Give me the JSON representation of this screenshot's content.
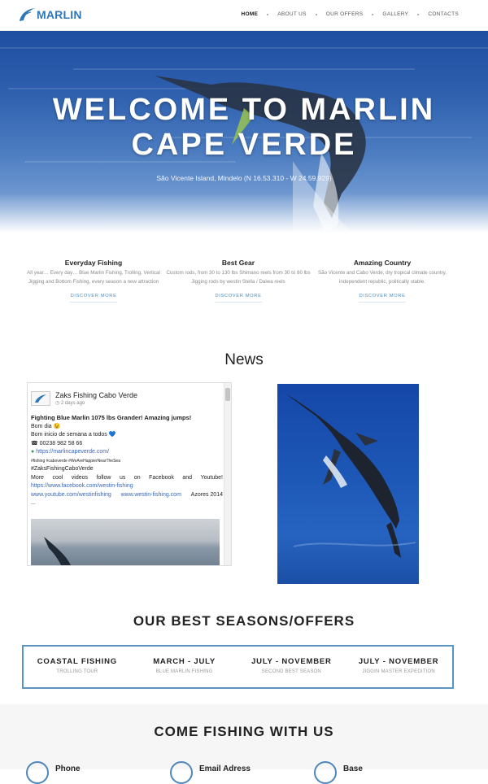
{
  "nav": {
    "logo_text": "MARLIN",
    "items": [
      {
        "label": "HOME",
        "active": true
      },
      {
        "label": "ABOUT US"
      },
      {
        "label": "OUR OFFERS"
      },
      {
        "label": "GALLERY"
      },
      {
        "label": "CONTACTS"
      }
    ]
  },
  "hero": {
    "title_line1": "WELCOME TO MARLIN",
    "title_line2": "CAPE VERDE",
    "subtitle": "São Vicente Island, Mindelo (N 16.53.310 - W 24.59.929)"
  },
  "features": [
    {
      "title": "Everyday Fishing",
      "text": "All year… Every day… Blue Marlin Fishing, Trolling, Vertical Jigging and Bottom Fishing, every season a new attraction",
      "link": "DISCOVER MORE"
    },
    {
      "title": "Best Gear",
      "text": "Custom rods, from 30 to 130 lbs Shimano reels from 30 to 80 lbs Jigging rods by westin Stella / Daiwa reels",
      "link": "DISCOVER MORE"
    },
    {
      "title": "Amazing Country",
      "text": "São Vicente and Cabo Verde, dry tropical climate country, independent republic, politically stable.",
      "link": "DISCOVER MORE"
    }
  ],
  "news": {
    "title": "News",
    "post": {
      "page_name": "Zaks Fishing Cabo Verde",
      "time": "2 days ago",
      "headline": "Fighting Blue Marlin 1075 lbs Grander! Amazing jumps!",
      "line1": "Bom dia 😉",
      "line2": "Bom inicio de semana a todos 💙",
      "phone": "☎ 00238 982 58 66",
      "site": "https://marlincapeverde.com/",
      "hashtags": "#fishing #caboverde #WeAreHappierNearTheSea",
      "hashtag_main": "#ZaksFishingCaboVerde",
      "more_text_a": "More",
      "more_text_b": "cool",
      "more_text_c": "videos",
      "more_text_d": "follow",
      "more_text_e": "us",
      "more_text_f": "on",
      "more_text_g": "Facebook",
      "more_text_h": "and",
      "more_text_i": "Youtube!",
      "fb_link": "https://www.facebook.com/westin-fishing",
      "yt_link": "www.youtube.com/westinfishing",
      "westin_link": "www.westin-fishing.com",
      "azores": "Azores 2014",
      "ellipsis": "..."
    }
  },
  "seasons": {
    "title": "OUR BEST SEASONS/OFFERS",
    "items": [
      {
        "title": "COASTAL FISHING",
        "sub": "TROLLING TOUR"
      },
      {
        "title": "MARCH - JULY",
        "sub": "BLUE MARLIN FISHING"
      },
      {
        "title": "JULY - NOVEMBER",
        "sub": "SECOND BEST SEASON"
      },
      {
        "title": "JULY - NOVEMBER",
        "sub": "JIGGIN MASTER EXPEDITION"
      }
    ]
  },
  "contact": {
    "title": "COME FISHING WITH US",
    "items": [
      {
        "label": "Phone"
      },
      {
        "label": "Email Adress"
      },
      {
        "label": "Base"
      }
    ]
  },
  "colors": {
    "accent": "#2e77b8",
    "border": "#5a95c4"
  }
}
